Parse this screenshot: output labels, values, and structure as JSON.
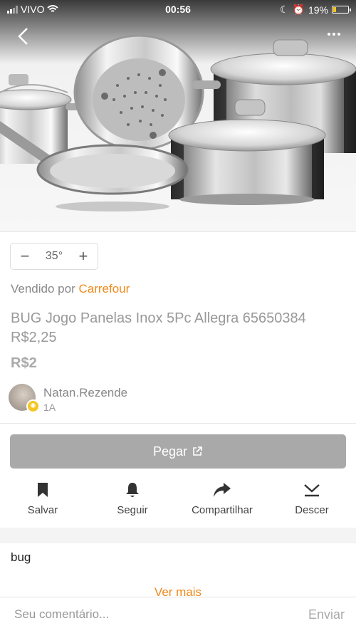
{
  "status_bar": {
    "carrier": "VIVO",
    "time": "00:56",
    "battery_percent": "19%",
    "battery_level": 0.19
  },
  "hero": {
    "image_icon": "cookware-set-image"
  },
  "zoom": {
    "value": "35°",
    "minus": "−",
    "plus": "+"
  },
  "seller": {
    "prefix": "Vendido por ",
    "store": "Carrefour"
  },
  "product": {
    "title": "BUG Jogo Panelas Inox 5Pc Allegra 65650384 R$2,25",
    "price": "R$2"
  },
  "user": {
    "name": "Natan.Rezende",
    "level": "1A"
  },
  "pegar": {
    "label": "Pegar"
  },
  "actions": [
    {
      "label": "Salvar",
      "icon": "bookmark-icon"
    },
    {
      "label": "Seguir",
      "icon": "bell-icon"
    },
    {
      "label": "Compartilhar",
      "icon": "share-icon"
    },
    {
      "label": "Descer",
      "icon": "download-icon"
    }
  ],
  "description": {
    "text": "bug",
    "more": "Ver mais"
  },
  "comment": {
    "placeholder": "Seu comentário...",
    "send": "Enviar"
  },
  "colors": {
    "accent": "#f08a1c",
    "button_gray": "#a9a9a9"
  }
}
